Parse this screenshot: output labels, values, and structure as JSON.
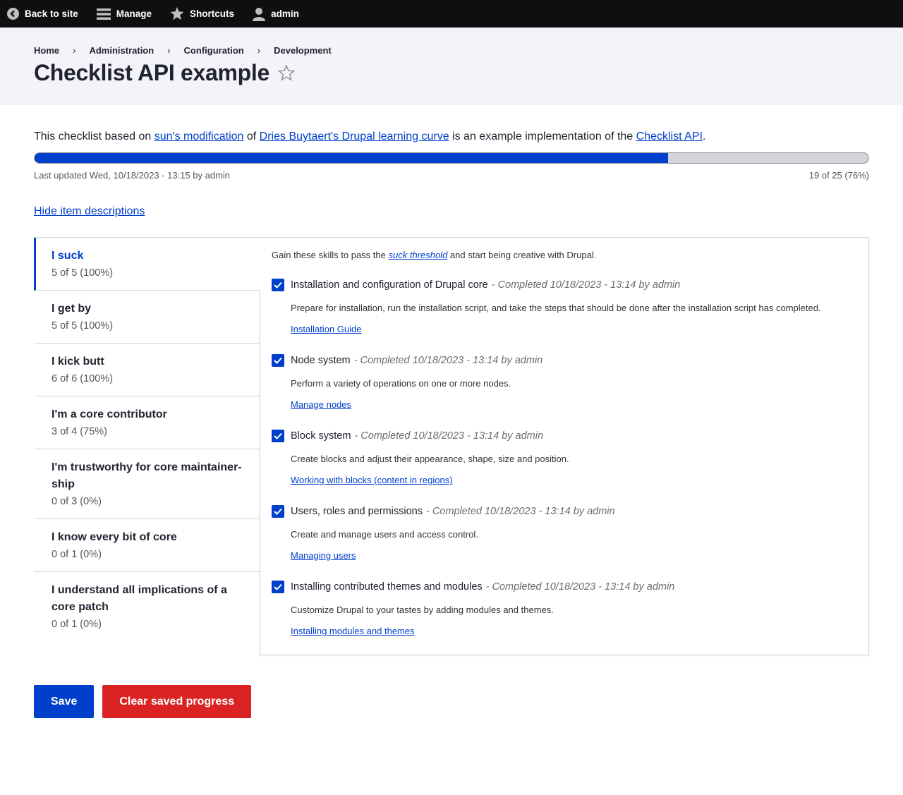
{
  "toolbar": {
    "back": "Back to site",
    "manage": "Manage",
    "shortcuts": "Shortcuts",
    "user": "admin"
  },
  "breadcrumb": [
    "Home",
    "Administration",
    "Configuration",
    "Development"
  ],
  "breadcrumb_separator": "›",
  "page_title": "Checklist API example",
  "intro": {
    "t1": "This checklist based on ",
    "l1": "sun's modification",
    "t2": " of ",
    "l2": "Dries Buytaert's Drupal learning curve",
    "t3": " is an example implementation of the ",
    "l3": "Checklist API",
    "t4": "."
  },
  "progress": {
    "fraction": 0.76,
    "last_updated": "Last updated Wed, 10/18/2023 - 13:15 by admin",
    "count": "19 of 25 (76%)"
  },
  "toggle_descriptions": "Hide item descriptions",
  "tabs": [
    {
      "title": "I suck",
      "summary": "5 of 5 (100%)"
    },
    {
      "title": "I get by",
      "summary": "5 of 5 (100%)"
    },
    {
      "title": "I kick butt",
      "summary": "6 of 6 (100%)"
    },
    {
      "title": "I'm a core contributor",
      "summary": "3 of 4 (75%)"
    },
    {
      "title": "I'm trustworthy for core maintainer­ship",
      "summary": "0 of 3 (0%)"
    },
    {
      "title": "I know every bit of core",
      "summary": "0 of 1 (0%)"
    },
    {
      "title": "I understand all implications of a core patch",
      "summary": "0 of 1 (0%)"
    }
  ],
  "panel": {
    "desc_before": "Gain these skills to pass the ",
    "desc_link": "suck threshold",
    "desc_after": " and start being creative with Drupal.",
    "items": [
      {
        "label": "Installation and configuration of Drupal core",
        "status": "- Completed 10/18/2023 - 13:14 by admin",
        "desc": "Prepare for installation, run the installation script, and take the steps that should be done after the installation script has completed.",
        "link": "Installation Guide"
      },
      {
        "label": "Node system",
        "status": "- Completed 10/18/2023 - 13:14 by admin",
        "desc": "Perform a variety of operations on one or more nodes.",
        "link": "Manage nodes"
      },
      {
        "label": "Block system",
        "status": "- Completed 10/18/2023 - 13:14 by admin",
        "desc": "Create blocks and adjust their appearance, shape, size and position.",
        "link": "Working with blocks (content in regions)"
      },
      {
        "label": "Users, roles and permissions",
        "status": "- Completed 10/18/2023 - 13:14 by admin",
        "desc": "Create and manage users and access control.",
        "link": "Managing users"
      },
      {
        "label": "Installing contributed themes and modules",
        "status": "- Completed 10/18/2023 - 13:14 by admin",
        "desc": "Customize Drupal to your tastes by adding modules and themes.",
        "link": "Installing modules and themes"
      }
    ]
  },
  "buttons": {
    "save": "Save",
    "clear": "Clear saved progress"
  },
  "colors": {
    "accent": "#003ecc",
    "danger": "#dc2323",
    "toolbar_bg": "#0f0f0f",
    "header_bg": "#f3f4f9"
  }
}
